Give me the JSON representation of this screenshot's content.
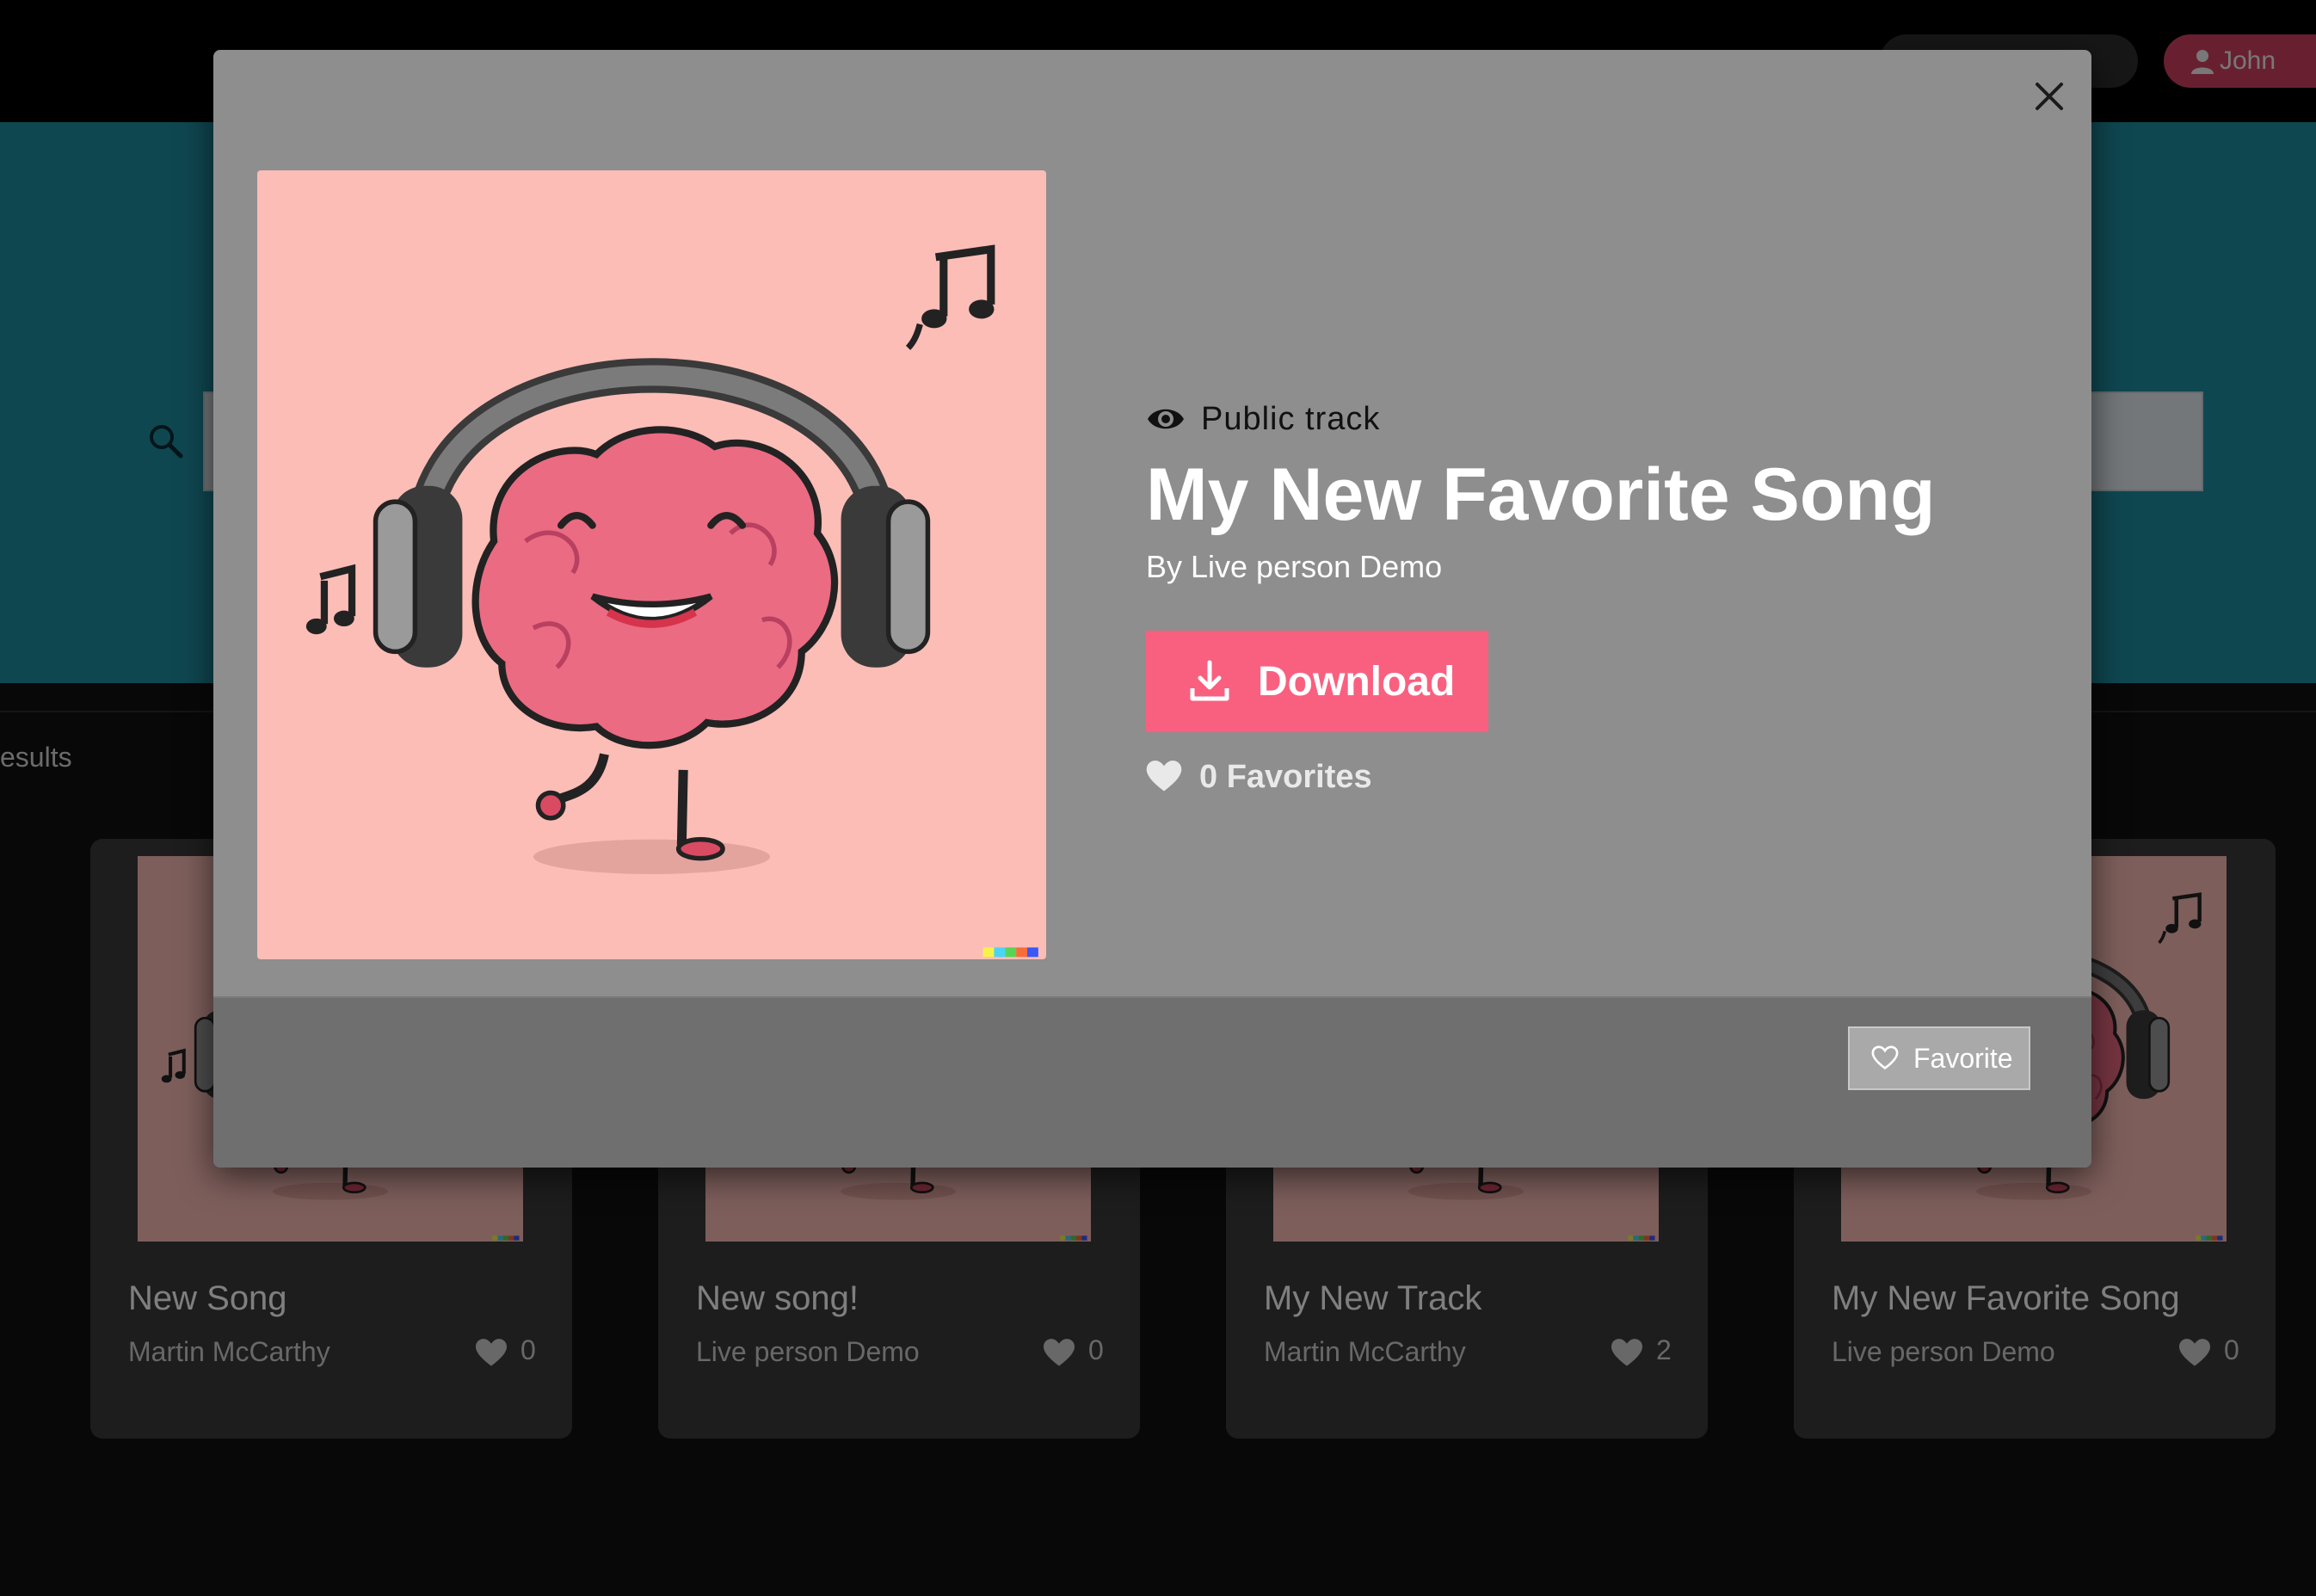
{
  "header": {
    "user_name": "John"
  },
  "results": {
    "label": "esults"
  },
  "cards": [
    {
      "title": "New Song",
      "artist": "Martin McCarthy",
      "favorites": "0"
    },
    {
      "title": "New song!",
      "artist": "Live person Demo",
      "favorites": "0"
    },
    {
      "title": "My New Track",
      "artist": "Martin McCarthy",
      "favorites": "2"
    },
    {
      "title": "My New Favorite Song",
      "artist": "Live person Demo",
      "favorites": "0"
    }
  ],
  "modal": {
    "visibility": "Public track",
    "title": "My New Favorite Song",
    "artist_line": "By Live person Demo",
    "download_label": "Download",
    "favorites_text": "0 Favorites",
    "favorite_button_label": "Favorite"
  },
  "icons": {
    "user": "user-icon",
    "search": "search-icon",
    "close": "close-icon",
    "eye": "eye-icon",
    "download": "download-icon",
    "heart": "heart-icon",
    "heart_outline": "heart-outline-icon"
  },
  "colors": {
    "accent_pink": "#f9607f",
    "hero_teal": "#1f8fa3",
    "user_pill": "#d04062",
    "cover_background": "#fbbdb6"
  }
}
